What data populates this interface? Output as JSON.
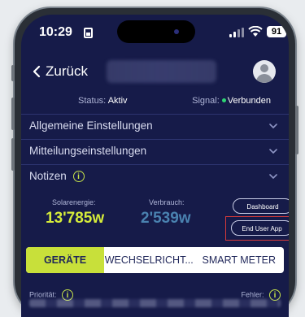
{
  "status_bar": {
    "time": "10:29",
    "battery": "91"
  },
  "nav": {
    "back_label": "Zurück"
  },
  "status": {
    "status_label": "Status:",
    "status_value": "Aktiv",
    "signal_label": "Signal:",
    "signal_value": "Verbunden"
  },
  "sections": [
    {
      "label": "Allgemeine Einstellungen"
    },
    {
      "label": "Mitteilungseinstellungen"
    },
    {
      "label": "Notizen"
    }
  ],
  "metrics": {
    "solar_label": "Solarenergie:",
    "solar_value": "13'785w",
    "consumption_label": "Verbrauch:",
    "consumption_value": "2'539w"
  },
  "buttons": {
    "dashboard": "Dashboard",
    "end_user_app": "End User App"
  },
  "tabs": [
    {
      "label": "GERÄTE",
      "active": true
    },
    {
      "label": "WECHSELRICHT...",
      "active": false
    },
    {
      "label": "SMART METER",
      "active": false
    }
  ],
  "footer": {
    "priority_label": "Priorität:",
    "error_label": "Fehler:"
  },
  "colors": {
    "background": "#161b49",
    "accent": "#c8e03a",
    "solar_value": "#d6ec3a",
    "consumption_value": "#4a82b0",
    "connected": "#2ed573",
    "highlight": "#d83a3a"
  },
  "icons": [
    "chevron-left-icon",
    "avatar-icon",
    "chevron-down-icon",
    "info-icon",
    "signal-icon",
    "wifi-icon",
    "battery-icon",
    "sim-icon"
  ]
}
